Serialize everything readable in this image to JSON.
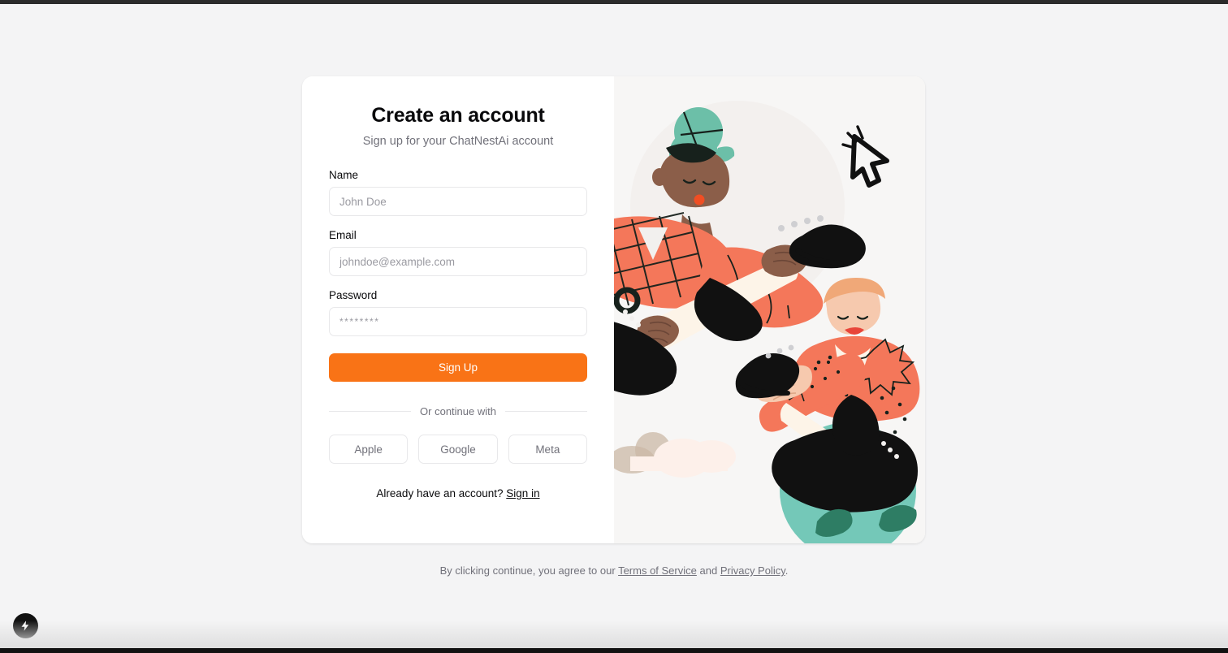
{
  "card": {
    "title": "Create an account",
    "subtitle": "Sign up for your ChatNestAi account",
    "fields": [
      {
        "label": "Name",
        "placeholder": "John Doe",
        "value": "",
        "type": "text"
      },
      {
        "label": "Email",
        "placeholder": "johndoe@example.com",
        "value": "",
        "type": "email"
      },
      {
        "label": "Password",
        "placeholder": "********",
        "value": "",
        "type": "password"
      }
    ],
    "submit_label": "Sign Up",
    "divider_label": "Or continue with",
    "social_buttons": [
      {
        "label": "Apple"
      },
      {
        "label": "Google"
      },
      {
        "label": "Meta"
      }
    ],
    "signin_prompt": "Already have an account?",
    "signin_link": "Sign in"
  },
  "footer": {
    "lead": "By clicking continue, you agree to our",
    "terms_link": "Terms of Service",
    "conjunction": "and",
    "privacy_link": "Privacy Policy",
    "period": "."
  },
  "fab": {
    "icon": "lightning-bolt-icon"
  },
  "colors": {
    "page_background": "#f4f4f5",
    "card_background": "#ffffff",
    "accent_orange": "#f97316",
    "art_background": "#f7f6f5",
    "coral": "#f4775a",
    "teal": "#6cbfa8",
    "teal_ball": "#74c8b8",
    "cream": "#fdf4e8",
    "skin_dark": "#8b5e49",
    "skin_light": "#f6c9ae",
    "black": "#111111",
    "cloud_tan": "#cbb8a6",
    "cloud_pink": "#fdf0ea",
    "text_primary": "#09090b",
    "text_muted": "#71717a",
    "border": "#e8e8ea"
  }
}
